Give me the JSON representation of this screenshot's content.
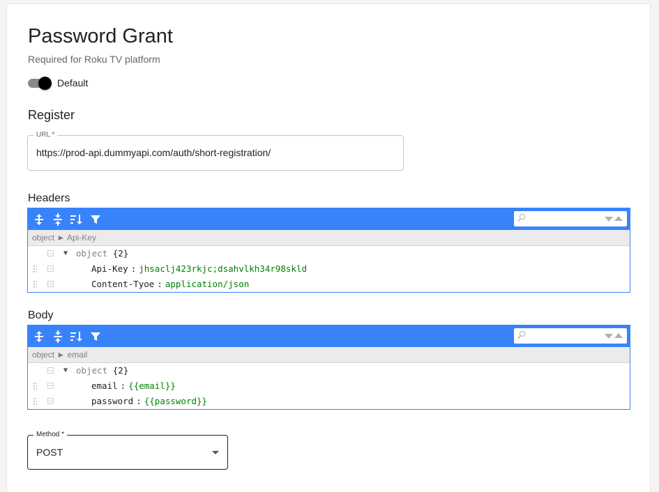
{
  "page": {
    "title": "Password Grant",
    "subtitle": "Required for Roku TV platform",
    "toggle": {
      "label": "Default",
      "checked": true
    }
  },
  "register": {
    "heading": "Register",
    "url": {
      "label": "URL *",
      "value": "https://prod-api.dummyapi.com/auth/short-registration/"
    }
  },
  "headers_editor": {
    "label": "Headers",
    "breadcrumb": [
      "object",
      "Api-Key"
    ],
    "root": {
      "type": "object",
      "count": "{2}"
    },
    "entries": [
      {
        "key": "Api-Key",
        "value": "jhsaclj423rkjc;dsahvlkh34r98skld"
      },
      {
        "key": "Content-Tyoe",
        "value": "application/json"
      }
    ]
  },
  "body_editor": {
    "label": "Body",
    "breadcrumb": [
      "object",
      "email"
    ],
    "root": {
      "type": "object",
      "count": "{2}"
    },
    "entries": [
      {
        "key": "email",
        "value": "{{email}}"
      },
      {
        "key": "password",
        "value": "{{password}}"
      }
    ]
  },
  "method": {
    "label": "Method *",
    "value": "POST"
  },
  "editor_toolbar": {
    "icons": [
      "expand-all-icon",
      "collapse-all-icon",
      "sort-icon",
      "filter-icon"
    ],
    "search_icon": "search-icon"
  },
  "colors": {
    "accent": "#3883fa",
    "value_text": "#008000",
    "toggle_thumb": "#000000"
  }
}
